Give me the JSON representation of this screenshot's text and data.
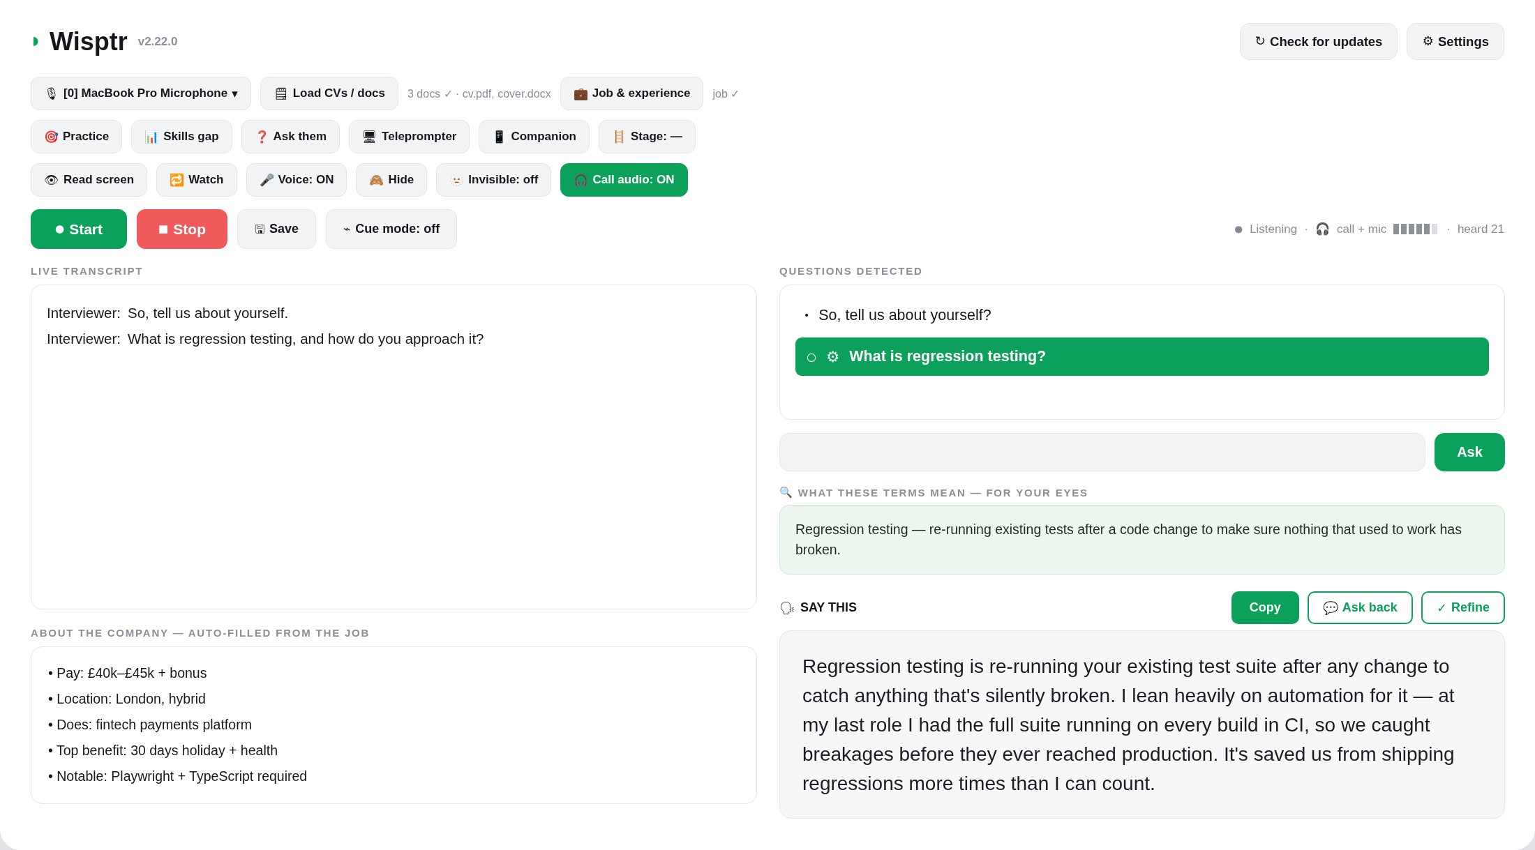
{
  "app": {
    "title": "Wisptr",
    "version": "v2.22.0"
  },
  "header_actions": [
    {
      "icon": "↻",
      "label": "Check for updates"
    },
    {
      "icon": "⚙",
      "label": "Settings"
    }
  ],
  "toolbar_rows": [
    {
      "items": [
        {
          "kind": "dropdown",
          "icon": "🎙",
          "label": "[0] MacBook Pro Microphone",
          "caret": "▾"
        },
        {
          "kind": "button",
          "icon": "🗒",
          "label": "Load CVs / docs",
          "active": false
        },
        {
          "kind": "note",
          "text": "3 docs ✓ · cv.pdf, cover.docx"
        },
        {
          "kind": "button",
          "icon": "💼",
          "label": "Job & experience",
          "active": false
        },
        {
          "kind": "note",
          "text": "job ✓"
        }
      ]
    },
    {
      "items": [
        {
          "kind": "button",
          "icon": "🎯",
          "label": "Practice",
          "active": false
        },
        {
          "kind": "button",
          "icon": "📊",
          "label": "Skills gap",
          "active": false
        },
        {
          "kind": "button",
          "icon": "❓",
          "label": "Ask them",
          "active": false
        },
        {
          "kind": "button",
          "icon": "🖥",
          "label": "Teleprompter",
          "active": false
        },
        {
          "kind": "button",
          "icon": "📱",
          "label": "Companion",
          "active": false
        },
        {
          "kind": "button",
          "icon": "🪜",
          "label": "Stage: —",
          "active": false
        }
      ]
    },
    {
      "items": [
        {
          "kind": "button",
          "icon": "👁",
          "label": "Read screen",
          "active": false
        },
        {
          "kind": "button",
          "icon": "🔁",
          "label": "Watch",
          "active": false
        },
        {
          "kind": "button",
          "icon": "🎤",
          "label": "Voice: ON",
          "active": false
        },
        {
          "kind": "button",
          "icon": "🙈",
          "label": "Hide",
          "active": false
        },
        {
          "kind": "button",
          "icon": "🫥",
          "label": "Invisible: off",
          "active": false
        },
        {
          "kind": "button",
          "icon": "🎧",
          "label": "Call audio: ON",
          "active": true
        }
      ]
    }
  ],
  "session_controls": [
    {
      "kind": "start",
      "icon": "●",
      "label": "Start"
    },
    {
      "kind": "stop",
      "icon": "■",
      "label": "Stop"
    },
    {
      "kind": "plain",
      "icon": "🖫",
      "label": "Save"
    },
    {
      "kind": "plain",
      "icon": "⌁",
      "label": "Cue mode: off"
    }
  ],
  "status": [
    {
      "kind": "state",
      "icon": "●",
      "text": "Listening"
    },
    {
      "kind": "separator",
      "text": "·"
    },
    {
      "kind": "source",
      "icon": "🎧",
      "text": "call + mic",
      "level": 0.83
    },
    {
      "kind": "separator",
      "text": "·"
    },
    {
      "kind": "text",
      "text": "heard 21"
    }
  ],
  "transcript": {
    "title": "LIVE TRANSCRIPT",
    "lines": [
      {
        "speaker": "Interviewer:",
        "text": "So, tell us about yourself."
      },
      {
        "speaker": "Interviewer:",
        "text": "What is regression testing, and how do you approach it?"
      }
    ]
  },
  "company": {
    "title": "ABOUT THE COMPANY — AUTO-FILLED FROM THE JOB",
    "items": [
      "• Pay: £40k–£45k + bonus",
      "• Location: London, hybrid",
      "• Does: fintech payments platform",
      "• Top benefit: 30 days holiday + health",
      "• Notable: Playwright + TypeScript required"
    ]
  },
  "questions": {
    "title": "QUESTIONS DETECTED",
    "items": [
      {
        "bullet": "•",
        "text": "So, tell us about yourself?",
        "selected": false
      },
      {
        "bullet": "○",
        "icon": "⚙",
        "text": "What is regression testing?",
        "selected": true
      }
    ]
  },
  "ask": {
    "button": "Ask"
  },
  "terms": {
    "icon": "🔍",
    "title": "WHAT THESE TERMS MEAN — FOR YOUR EYES",
    "text": "Regression testing — re-running existing tests after a code change to make sure nothing that used to work has broken."
  },
  "say_this": {
    "icon": "🗣",
    "title": "SAY THIS",
    "actions": [
      {
        "kind": "filled",
        "label": "Copy"
      },
      {
        "kind": "outline",
        "icon": "💬",
        "label": "Ask back"
      },
      {
        "kind": "outline",
        "icon": "✓",
        "label": "Refine"
      }
    ],
    "text": "Regression testing is re-running your existing test suite after any change to catch anything that's silently broken. I lean heavily on automation for it — at my last role I had the full suite running on every build in CI, so we caught breakages before they ever reached production. It's saved us from shipping regressions more times than I can count."
  }
}
